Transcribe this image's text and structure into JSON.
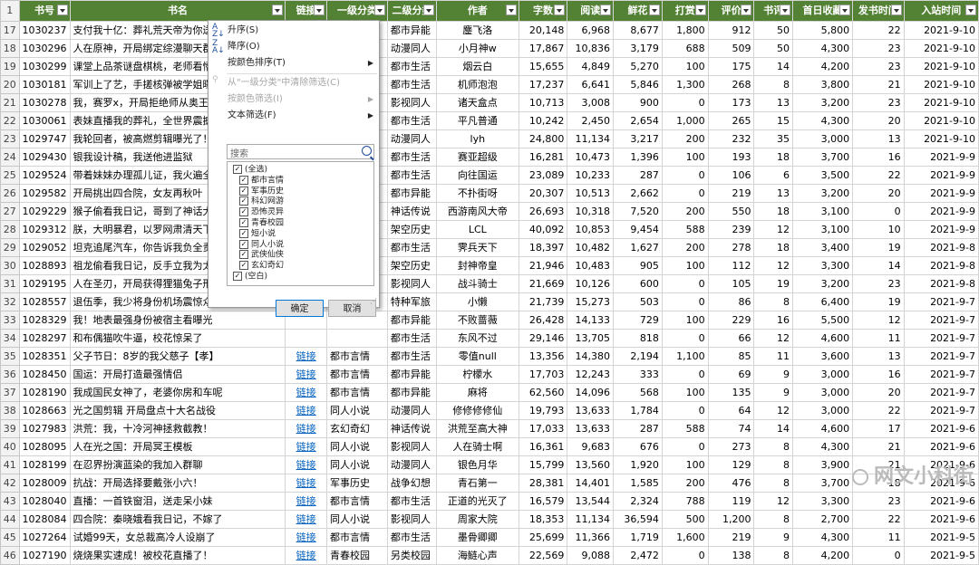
{
  "headers": [
    "书号",
    "书名",
    "链接",
    "一级分类",
    "二级分类",
    "作者",
    "字数",
    "阅读",
    "鲜花",
    "打赏",
    "评价",
    "书评",
    "首日收藏",
    "发书时间",
    "入站时间"
  ],
  "header_row_number": "1",
  "rows": [
    [
      "17",
      "1030237",
      "支付我十亿：葬礼荒天帝为你送",
      "",
      "",
      "都市异能",
      "鏖飞洛",
      "20,148",
      "6,968",
      "8,677",
      "1,800",
      "912",
      "50",
      "5,800",
      "22",
      "2021-9-10"
    ],
    [
      "18",
      "1030296",
      "人在原神，开局绑定综漫聊天群",
      "",
      "",
      "动漫同人",
      "小月神w",
      "17,867",
      "10,836",
      "3,179",
      "688",
      "509",
      "50",
      "4,300",
      "23",
      "2021-9-10"
    ],
    [
      "19",
      "1030299",
      "课堂上品茶谜盘棋桃，老师看懵了",
      "",
      "",
      "都市生活",
      "烟云白",
      "15,655",
      "4,849",
      "5,270",
      "100",
      "175",
      "14",
      "4,200",
      "23",
      "2021-9-10"
    ],
    [
      "20",
      "1030181",
      "军训上了艺，手搓核弹被学姐曝光了",
      "",
      "",
      "都市生活",
      "机师泡泡",
      "17,237",
      "6,641",
      "5,846",
      "1,300",
      "268",
      "8",
      "3,800",
      "21",
      "2021-9-10"
    ],
    [
      "21",
      "1030278",
      "我，赛罗x，开局拒绝师从奥王",
      "",
      "",
      "影视同人",
      "诸天盒点",
      "10,713",
      "3,008",
      "900",
      "0",
      "173",
      "13",
      "3,200",
      "23",
      "2021-9-10"
    ],
    [
      "22",
      "1030061",
      "表妹直播我的葬礼，全世界震撼了",
      "",
      "",
      "都市生活",
      "平凡普通",
      "10,242",
      "2,450",
      "2,654",
      "1,000",
      "265",
      "15",
      "4,300",
      "20",
      "2021-9-10"
    ],
    [
      "23",
      "1029747",
      "我轮回者，被高燃剪辑曝光了！",
      "",
      "",
      "动漫同人",
      "lyh",
      "24,800",
      "11,134",
      "3,217",
      "200",
      "232",
      "35",
      "3,000",
      "13",
      "2021-9-10"
    ],
    [
      "24",
      "1029430",
      "银我设计稿，我送他进监狱",
      "",
      "",
      "都市生活",
      "赛亚超级",
      "16,281",
      "10,473",
      "1,396",
      "100",
      "193",
      "18",
      "3,700",
      "16",
      "2021-9-9"
    ],
    [
      "25",
      "1029524",
      "带着妹妹办理孤儿证，我火遍全网",
      "",
      "",
      "都市生活",
      "向往国运",
      "23,089",
      "10,233",
      "287",
      "0",
      "106",
      "6",
      "3,500",
      "22",
      "2021-9-9"
    ],
    [
      "26",
      "1029582",
      "开局挑出四合院，女友再秋叶",
      "",
      "",
      "都市异能",
      "不扑街呀",
      "20,307",
      "10,513",
      "2,662",
      "0",
      "219",
      "13",
      "3,200",
      "20",
      "2021-9-9"
    ],
    [
      "27",
      "1029229",
      "猴子偷看我日记，哥到了神话大圣",
      "",
      "",
      "神话传说",
      "西游南风大帝",
      "26,693",
      "10,318",
      "7,520",
      "200",
      "550",
      "18",
      "3,100",
      "0",
      "2021-9-9"
    ],
    [
      "28",
      "1029312",
      "朕，大明暴君，以罗网肃清天下",
      "",
      "",
      "架空历史",
      "LCL",
      "40,092",
      "10,853",
      "9,454",
      "588",
      "239",
      "12",
      "3,100",
      "10",
      "2021-9-9"
    ],
    [
      "29",
      "1029052",
      "坦克追尾汽车，你告诉我负全责",
      "",
      "",
      "都市生活",
      "霁兵天下",
      "18,397",
      "10,482",
      "1,627",
      "200",
      "278",
      "18",
      "3,400",
      "19",
      "2021-9-8"
    ],
    [
      "30",
      "1028893",
      "祖龙偷看我日记，反手立我为太子",
      "",
      "",
      "架空历史",
      "封神帝皇",
      "21,946",
      "10,483",
      "905",
      "100",
      "112",
      "12",
      "3,300",
      "14",
      "2021-9-8"
    ],
    [
      "31",
      "1029195",
      "人在圣刃，开局获得狸猫兔子形态",
      "",
      "",
      "影视同人",
      "战斗骑士",
      "21,669",
      "10,126",
      "600",
      "0",
      "105",
      "19",
      "3,200",
      "23",
      "2021-9-8"
    ],
    [
      "32",
      "1028557",
      "退伍季，我少将身份机场震惊众人",
      "",
      "",
      "特种军旅",
      "小懒",
      "21,739",
      "15,273",
      "503",
      "0",
      "86",
      "8",
      "6,400",
      "19",
      "2021-9-7"
    ],
    [
      "33",
      "1028329",
      "我！地表最强身份被宿主看曝光",
      "",
      "",
      "都市异能",
      "不败蔷薇",
      "26,428",
      "14,133",
      "729",
      "100",
      "229",
      "16",
      "5,500",
      "12",
      "2021-9-7"
    ],
    [
      "34",
      "1028297",
      "和布偶猫吹牛逼，校花惊呆了",
      "",
      "",
      "都市生活",
      "东风不过",
      "29,146",
      "13,705",
      "818",
      "0",
      "66",
      "12",
      "4,600",
      "11",
      "2021-9-7"
    ],
    [
      "35",
      "1028351",
      "父子节日：8岁的我父慈子【孝】",
      "链接",
      "都市言情",
      "都市生活",
      "零值null",
      "13,356",
      "14,380",
      "2,194",
      "1,100",
      "85",
      "11",
      "3,600",
      "13",
      "2021-9-7"
    ],
    [
      "36",
      "1028450",
      "国运：开局打造最强情侣",
      "链接",
      "都市言情",
      "都市异能",
      "柠檬水",
      "17,703",
      "12,243",
      "333",
      "0",
      "69",
      "9",
      "3,000",
      "16",
      "2021-9-7"
    ],
    [
      "37",
      "1028190",
      "我成国民女神了，老婆你房和车呢",
      "链接",
      "都市言情",
      "都市异能",
      "麻将",
      "62,560",
      "14,096",
      "568",
      "100",
      "135",
      "9",
      "3,000",
      "20",
      "2021-9-7"
    ],
    [
      "38",
      "1028663",
      "光之国剪辑 开局盘点十大名战役",
      "链接",
      "同人小说",
      "动漫同人",
      "修修修修仙",
      "19,793",
      "13,633",
      "1,784",
      "0",
      "64",
      "12",
      "3,000",
      "22",
      "2021-9-7"
    ],
    [
      "39",
      "1027983",
      "洪荒：我，十冷河神拯救截教！",
      "链接",
      "玄幻奇幻",
      "神话传说",
      "洪荒至高大神",
      "17,033",
      "13,633",
      "287",
      "588",
      "74",
      "14",
      "4,600",
      "17",
      "2021-9-6"
    ],
    [
      "40",
      "1028095",
      "人在光之国：开局冥王模板",
      "链接",
      "同人小说",
      "影视同人",
      "人在骑士啊",
      "16,361",
      "9,683",
      "676",
      "0",
      "273",
      "8",
      "4,300",
      "21",
      "2021-9-6"
    ],
    [
      "41",
      "1028199",
      "在忍界扮演蓝染的我加入群聊",
      "链接",
      "同人小说",
      "动漫同人",
      "银色月华",
      "15,799",
      "13,560",
      "1,920",
      "100",
      "129",
      "8",
      "3,900",
      "21",
      "2021-9-6"
    ],
    [
      "42",
      "1028009",
      "抗战：开局选择要戴张小六！",
      "链接",
      "军事历史",
      "战争幻想",
      "青石第一",
      "28,381",
      "14,401",
      "1,585",
      "200",
      "476",
      "8",
      "3,700",
      "18",
      "2021-9-6"
    ],
    [
      "43",
      "1028040",
      "直播：一首铁窗泪，送走呆小妹",
      "链接",
      "都市言情",
      "都市生活",
      "正道的光灭了",
      "16,579",
      "13,544",
      "2,324",
      "788",
      "119",
      "12",
      "3,300",
      "23",
      "2021-9-6"
    ],
    [
      "44",
      "1028084",
      "四合院：秦晓娥看我日记，不嫁了",
      "链接",
      "同人小说",
      "影视同人",
      "周家大院",
      "18,353",
      "11,134",
      "36,594",
      "500",
      "1,200",
      "8",
      "2,700",
      "22",
      "2021-9-6"
    ],
    [
      "45",
      "1027264",
      "试婚99天，女总裁高冷人设崩了",
      "链接",
      "都市言情",
      "都市生活",
      "墨骨卿卿",
      "25,699",
      "11,366",
      "1,719",
      "1,600",
      "219",
      "9",
      "4,300",
      "11",
      "2021-9-5"
    ],
    [
      "46",
      "1027190",
      "烧烧果实速成！被校花直播了！",
      "链接",
      "青春校园",
      "另类校园",
      "海鲢心声",
      "22,569",
      "9,088",
      "2,472",
      "0",
      "138",
      "8",
      "4,200",
      "0",
      "2021-9-5"
    ]
  ],
  "filter_menu": {
    "sort_asc": "升序(S)",
    "sort_desc": "降序(O)",
    "sort_by_color": "按颜色排序(T)",
    "clear_filter": "从\"一级分类\"中清除筛选(C)",
    "filter_by_color": "按颜色筛选(I)",
    "text_filter": "文本筛选(F)",
    "search_placeholder": "搜索",
    "options": [
      "(全选)",
      "都市言情",
      "军事历史",
      "科幻网游",
      "恐怖灵异",
      "青春校园",
      "短小说",
      "同人小说",
      "武侠仙侠",
      "玄幻奇幻",
      "(空白)"
    ],
    "ok": "确定",
    "cancel": "取消"
  },
  "watermark": "网文小科街"
}
